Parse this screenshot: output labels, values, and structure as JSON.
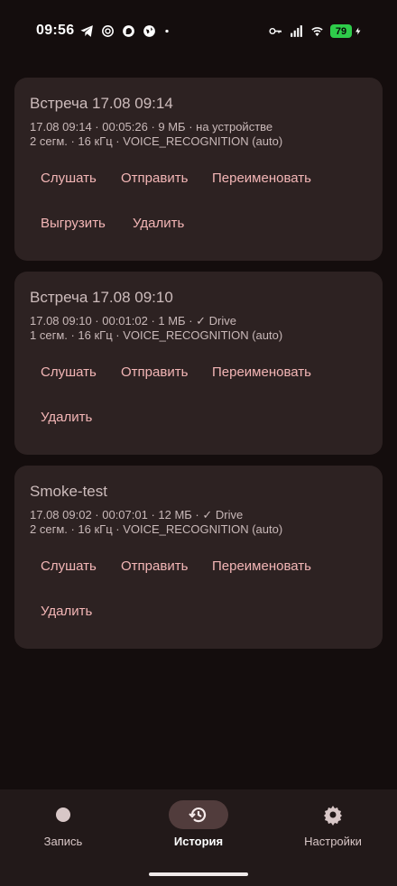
{
  "status_bar": {
    "time": "09:56",
    "battery": "79",
    "icons_left": [
      "telegram-icon",
      "chatgpt-icon",
      "signal-app-icon",
      "globe-app-icon",
      "dot-icon"
    ],
    "icons_right": [
      "key-icon",
      "cellular-icon",
      "wifi-icon",
      "battery-icon",
      "charging-icon"
    ]
  },
  "recordings": [
    {
      "title": "Встреча 17.08 09:14",
      "meta_line1": "17.08 09:14 · 00:05:26 · 9 МБ · на устройстве",
      "meta_line2": "2 сегм. · 16 кГц · VOICE_RECOGNITION (auto)",
      "actions": [
        "Слушать",
        "Отправить",
        "Переименовать",
        "Выгрузить",
        "Удалить"
      ]
    },
    {
      "title": "Встреча 17.08 09:10",
      "meta_line1": "17.08 09:10 · 00:01:02 · 1 МБ · ✓ Drive",
      "meta_line2": "1 сегм. · 16 кГц · VOICE_RECOGNITION (auto)",
      "actions": [
        "Слушать",
        "Отправить",
        "Переименовать",
        "Удалить"
      ]
    },
    {
      "title": "Smoke-test",
      "meta_line1": "17.08 09:02 · 00:07:01 · 12 МБ · ✓ Drive",
      "meta_line2": "2 сегм. · 16 кГц · VOICE_RECOGNITION (auto)",
      "actions": [
        "Слушать",
        "Отправить",
        "Переименовать",
        "Удалить"
      ]
    }
  ],
  "bottom_nav": {
    "items": [
      {
        "label": "Запись",
        "icon": "record-dot-icon",
        "active": false
      },
      {
        "label": "История",
        "icon": "history-icon",
        "active": true
      },
      {
        "label": "Настройки",
        "icon": "gear-icon",
        "active": false
      }
    ]
  },
  "colors": {
    "background": "#140d0d",
    "card": "#2d2222",
    "action_text": "#f3b6b6",
    "nav_active_pill": "#513c3c",
    "battery": "#2ecc4a"
  }
}
